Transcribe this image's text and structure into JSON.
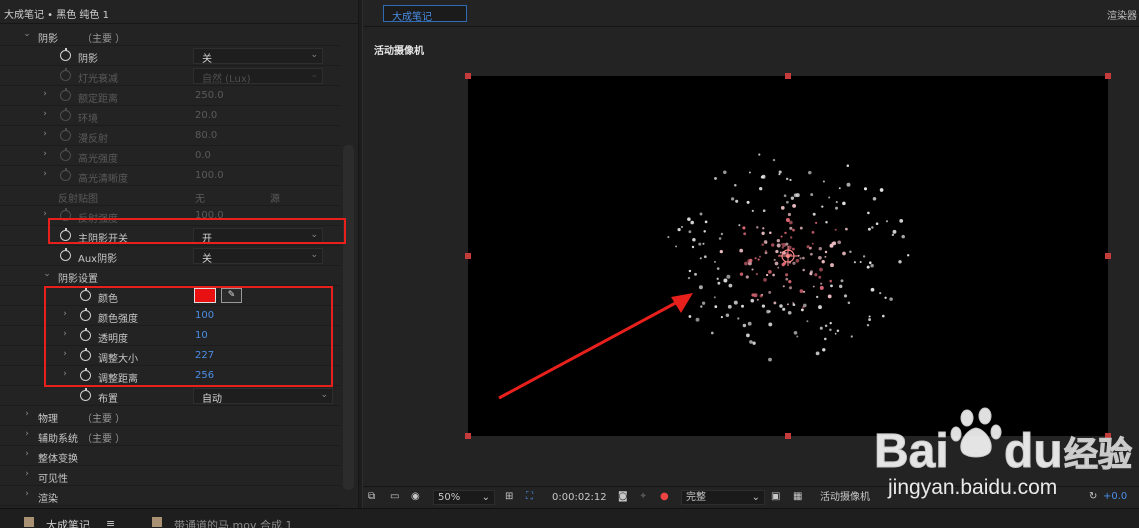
{
  "left_panel": {
    "header": "大成笔记 • 黑色 纯色 1",
    "rows": [
      {
        "type": "group",
        "label": "阴影",
        "suffix": "（主要 ）",
        "indent": 0
      },
      {
        "type": "prop",
        "label": "阴影",
        "value": "关",
        "control": "dropdown",
        "indent": 1
      },
      {
        "type": "prop",
        "label": "灯光衰减",
        "value": "自然 (Lux)",
        "control": "dropdown",
        "disabled": true,
        "indent": 1
      },
      {
        "type": "prop",
        "label": "额定距离",
        "value": "250.0",
        "disabled": true,
        "expandable": true,
        "indent": 1
      },
      {
        "type": "prop",
        "label": "环境",
        "value": "20.0",
        "disabled": true,
        "expandable": true,
        "indent": 1
      },
      {
        "type": "prop",
        "label": "漫反射",
        "value": "80.0",
        "disabled": true,
        "expandable": true,
        "indent": 1
      },
      {
        "type": "prop",
        "label": "高光强度",
        "value": "0.0",
        "disabled": true,
        "expandable": true,
        "indent": 1
      },
      {
        "type": "prop",
        "label": "高光清晰度",
        "value": "100.0",
        "disabled": true,
        "expandable": true,
        "indent": 1
      },
      {
        "type": "prop",
        "label": "反射贴图",
        "value": "无",
        "value2": "源",
        "disabled": true,
        "nostopwatch": true,
        "indent": 1
      },
      {
        "type": "prop",
        "label": "反射强度",
        "value": "100.0",
        "disabled": true,
        "expandable": true,
        "indent": 1
      },
      {
        "type": "prop",
        "label": "主阴影开关",
        "value": "开",
        "control": "dropdown",
        "indent": 1
      },
      {
        "type": "prop",
        "label": "Aux阴影",
        "value": "关",
        "control": "dropdown",
        "indent": 1
      },
      {
        "type": "group",
        "label": "阴影设置",
        "suffix": "",
        "indent": 1
      },
      {
        "type": "prop",
        "label": "颜色",
        "control": "color",
        "swatch": "#e81010",
        "indent": 2
      },
      {
        "type": "prop",
        "label": "颜色强度",
        "value": "100",
        "blue": true,
        "expandable": true,
        "indent": 2
      },
      {
        "type": "prop",
        "label": "透明度",
        "value": "10",
        "blue": true,
        "expandable": true,
        "indent": 2
      },
      {
        "type": "prop",
        "label": "调整大小",
        "value": "227",
        "blue": true,
        "expandable": true,
        "indent": 2
      },
      {
        "type": "prop",
        "label": "调整距离",
        "value": "256",
        "blue": true,
        "expandable": true,
        "indent": 2
      },
      {
        "type": "prop",
        "label": "布置",
        "value": "自动",
        "control": "dropdown-wide",
        "indent": 2
      },
      {
        "type": "group",
        "label": "物理",
        "suffix": "（主要 ）",
        "indent": 0
      },
      {
        "type": "group",
        "label": "辅助系统",
        "suffix": "（主要 ）",
        "indent": 0
      },
      {
        "type": "group",
        "label": "整体变换",
        "suffix": "",
        "indent": 0
      },
      {
        "type": "group",
        "label": "可见性",
        "suffix": "",
        "indent": 0
      },
      {
        "type": "group",
        "label": "渲染",
        "suffix": "",
        "indent": 0
      }
    ]
  },
  "viewer": {
    "tab": "大成笔记",
    "renderer": "渲染器",
    "camera": "活动摄像机",
    "toolbar": {
      "zoom": "50%",
      "timecode": "0:00:02:12",
      "resolution": "完整",
      "view": "活动摄像机",
      "exposure": "+0.0"
    }
  },
  "bottom_tabs": [
    {
      "label": "大成笔记",
      "suffix": "≡"
    },
    {
      "label": "带通道的马.mov 合成 1",
      "suffix": ""
    }
  ],
  "watermark": {
    "brand": "Bai",
    "brand2": "du",
    "site_cn": "经验",
    "url": "jingyan.baidu.com"
  },
  "colors": {
    "accent_blue": "#4b8ee6",
    "highlight_red": "#e8201c",
    "shadow_color": "#e81010"
  }
}
